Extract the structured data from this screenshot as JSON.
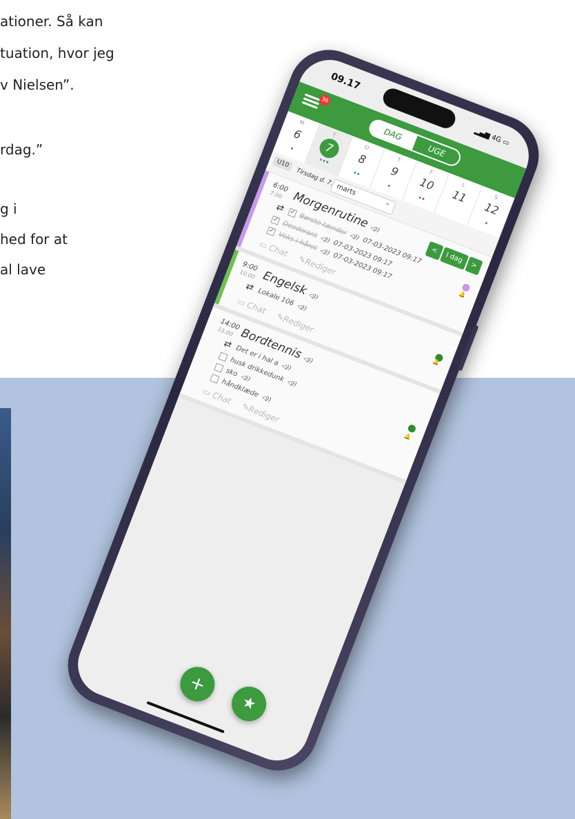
{
  "background_text": [
    "ationer. Så kan",
    "tuation, hvor jeg",
    "v Nielsen”.",
    "rdag.”",
    "g i",
    "hed for at",
    "al lave"
  ],
  "status_bar": {
    "time": "09.17",
    "signal": "4G"
  },
  "header": {
    "notification_count": "36",
    "tab_day": "DAG",
    "tab_week": "UGE",
    "active_tab": "DAG"
  },
  "days": [
    {
      "weekday": "M",
      "date": "6",
      "selected": false,
      "dots": [
        "#3d9a3f"
      ]
    },
    {
      "weekday": "T",
      "date": "7",
      "selected": true,
      "dots": [
        "#9c6ade",
        "#3d9a3f",
        "#3d9a3f"
      ]
    },
    {
      "weekday": "O",
      "date": "8",
      "selected": false,
      "dots": [
        "#3d9a3f",
        "#3d9a3f"
      ]
    },
    {
      "weekday": "T",
      "date": "9",
      "selected": false,
      "dots": [
        "#3d9a3f"
      ]
    },
    {
      "weekday": "F",
      "date": "10",
      "selected": false,
      "dots": [
        "#3d9a3f",
        "#e53935"
      ]
    },
    {
      "weekday": "L",
      "date": "11",
      "selected": false,
      "dots": []
    },
    {
      "weekday": "S",
      "date": "12",
      "selected": false,
      "dots": [
        "#3d9a3f"
      ]
    }
  ],
  "date_bar": {
    "week": "U10",
    "date_label": "Tirsdag d. 7.",
    "month": "marts"
  },
  "nav": {
    "prev": "<",
    "today": "I dag",
    "next": ">"
  },
  "events": [
    {
      "start": "6:00",
      "end": "7:00",
      "title": "Morgenrutine",
      "accent": "#c89ae8",
      "status_color": "#c89ae8",
      "items": [
        {
          "text": "Børste tænder",
          "checked": true,
          "timestamp": "07-03-2023 09:17"
        },
        {
          "text": "Deodorant",
          "checked": true,
          "timestamp": "07-03-2023 09:17"
        },
        {
          "text": "Voks i håret",
          "checked": true,
          "timestamp": "07-03-2023 09:17"
        }
      ]
    },
    {
      "start": "9:00",
      "end": "10:00",
      "title": "Engelsk",
      "accent": "#6fbf55",
      "status_color": "#2e8b2e",
      "note": "Lokale 106",
      "items": []
    },
    {
      "start": "14:00",
      "end": "15:00",
      "title": "Bordtennis",
      "accent": "",
      "status_color": "#2e8b2e",
      "note": "Det er i hal a",
      "items": [
        {
          "text": "husk drikkedunk",
          "checked": false,
          "timestamp": ""
        },
        {
          "text": "sko",
          "checked": false,
          "timestamp": ""
        },
        {
          "text": "håndklæde",
          "checked": false,
          "timestamp": ""
        }
      ]
    }
  ],
  "actions": {
    "chat": "Chat",
    "edit": "Rediger"
  },
  "fab": {
    "add": "+",
    "favorite": "★"
  },
  "icons": [
    "menu-icon",
    "repeat-icon",
    "speaker-icon",
    "chat-icon",
    "edit-icon",
    "bell-icon",
    "plus-icon",
    "star-icon"
  ]
}
